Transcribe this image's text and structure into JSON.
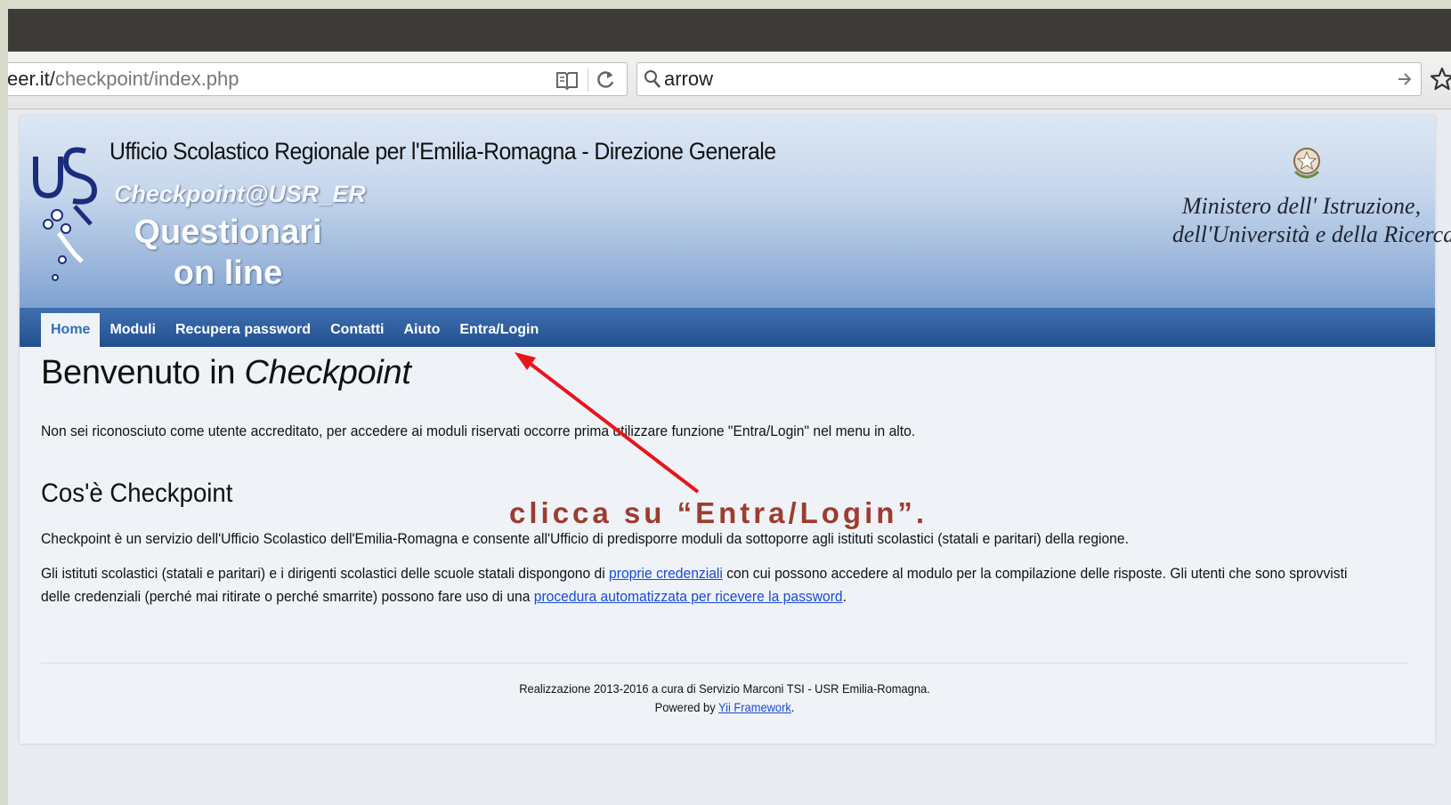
{
  "browser": {
    "url_prefix": "eer.it/",
    "url_path": "checkpoint/index.php",
    "search_value": "arrow"
  },
  "header": {
    "org_title": "Ufficio Scolastico Regionale per l'Emilia-Romagna - Direzione Generale",
    "app_name": "Checkpoint@USR_ER",
    "app_sub_1": "Questionari",
    "app_sub_2": "on line",
    "ministry_1": "Ministero dell' Istruzione,",
    "ministry_2": "dell'Università e della Ricerca"
  },
  "nav": {
    "items": [
      {
        "label": "Home",
        "active": true
      },
      {
        "label": "Moduli"
      },
      {
        "label": "Recupera password"
      },
      {
        "label": "Contatti"
      },
      {
        "label": "Aiuto"
      },
      {
        "label": "Entra/Login"
      }
    ]
  },
  "main": {
    "title_plain": "Benvenuto in ",
    "title_italic": "Checkpoint",
    "intro": "Non sei riconosciuto come utente accreditato, per accedere ai moduli riservati occorre prima utilizzare funzione \"Entra/Login\" nel menu in alto.",
    "section_title": "Cos'è Checkpoint",
    "para1": "Checkpoint è un servizio dell'Ufficio Scolastico dell'Emilia-Romagna e consente all'Ufficio di predisporre moduli da sottoporre agli istituti scolastici (statali e paritari) della regione.",
    "para2_a": "Gli istituti scolastici (statali e paritari) e i dirigenti scolastici delle scuole statali dispongono di ",
    "para2_link1": "proprie credenziali",
    "para2_b": " con cui possono accedere al modulo per la compilazione delle risposte. Gli utenti che sono sprovvisti",
    "para2_c": "delle credenziali (perché mai ritirate o perché smarrite) possono fare uso di una ",
    "para2_link2": "procedura automatizzata per ricevere la password",
    "para2_d": "."
  },
  "footer": {
    "line1": "Realizzazione 2013-2016 a cura di Servizio Marconi TSI - USR Emilia-Romagna.",
    "powered_prefix": "Powered by ",
    "powered_link": "Yii Framework",
    "powered_suffix": "."
  },
  "annotation": {
    "text": "clicca su “Entra/Login”.",
    "color": "#9c3d2f",
    "arrow_color": "#e8141c"
  },
  "colors": {
    "nav_bg": "#2f5f9f",
    "link": "#1a4bd6",
    "titlebar": "#3c3b37"
  }
}
